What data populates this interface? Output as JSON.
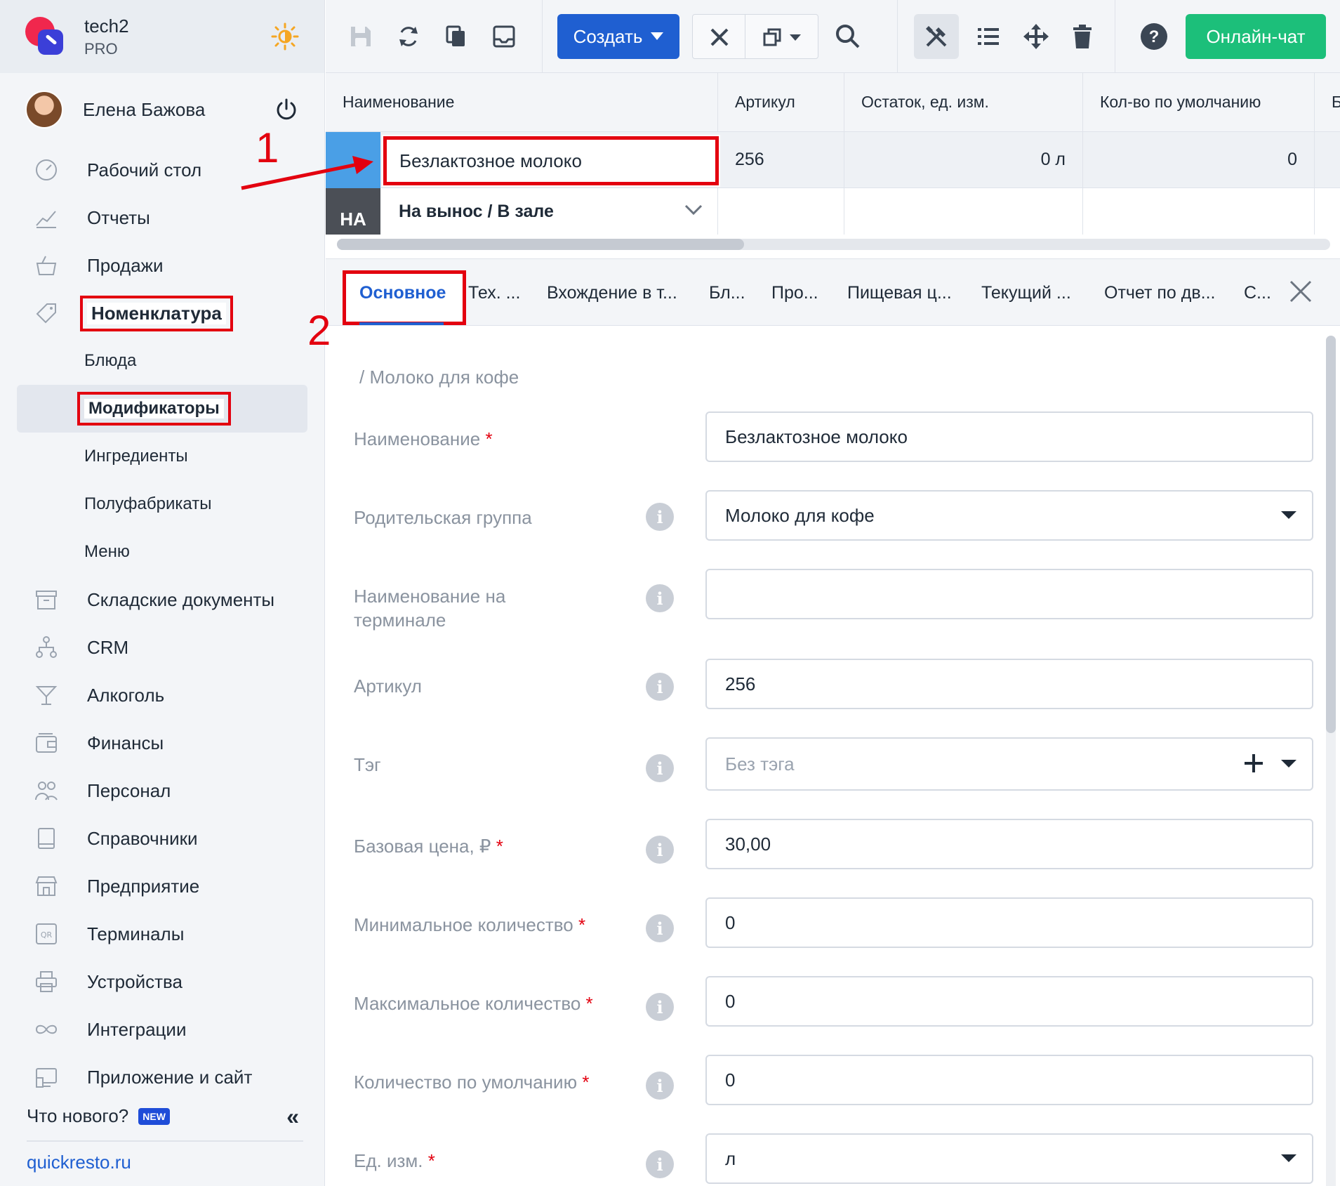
{
  "brand": {
    "name": "tech2",
    "plan": "PRO"
  },
  "user": {
    "name": "Елена Бажова"
  },
  "nav": {
    "desktop": "Рабочий стол",
    "reports": "Отчеты",
    "sales": "Продажи",
    "nomenclature": "Номенклатура",
    "sub": {
      "dishes": "Блюда",
      "modifiers": "Модификаторы",
      "ingredients": "Ингредиенты",
      "semi": "Полуфабрикаты",
      "menu": "Меню"
    },
    "warehouse": "Складские документы",
    "crm": "CRM",
    "alcohol": "Алкоголь",
    "finance": "Финансы",
    "staff": "Персонал",
    "directories": "Справочники",
    "enterprise": "Предприятие",
    "terminals": "Терминалы",
    "devices": "Устройства",
    "integrations": "Интеграции",
    "app_site": "Приложение и сайт"
  },
  "footer": {
    "whats_new": "Что нового?",
    "new_badge": "NEW",
    "site": "quickresto.ru"
  },
  "toolbar": {
    "create": "Создать",
    "chat": "Онлайн-чат"
  },
  "grid": {
    "columns": [
      "Наименование",
      "Артикул",
      "Остаток, ед. изм.",
      "Кол-во по умолчанию",
      "Б"
    ],
    "row1": {
      "name": "Безлактозное молоко",
      "article": "256",
      "stock": "0 л",
      "default_qty": "0"
    },
    "row2": {
      "marker": "НА",
      "name": "На вынос / В зале"
    }
  },
  "tabs": [
    "Основное",
    "Тех. ...",
    "Вхождение в т...",
    "Бл...",
    "Про...",
    "Пищевая ц...",
    "Текущий ...",
    "Отчет по дв...",
    "С..."
  ],
  "annotations": {
    "one": "1",
    "two": "2"
  },
  "form": {
    "breadcrumb": "/ Молоко для кофе",
    "fields": {
      "name": {
        "label": "Наименование",
        "value": "Безлактозное молоко"
      },
      "parent": {
        "label": "Родительская группа",
        "value": "Молоко для кофе"
      },
      "terminal_name": {
        "label": "Наименование на терминале",
        "value": ""
      },
      "article": {
        "label": "Артикул",
        "value": "256"
      },
      "tag": {
        "label": "Тэг",
        "placeholder": "Без тэга"
      },
      "base_price": {
        "label": "Базовая цена, ₽",
        "value": "30,00"
      },
      "min_qty": {
        "label": "Минимальное количество",
        "value": "0"
      },
      "max_qty": {
        "label": "Максимальное количество",
        "value": "0"
      },
      "default_qty": {
        "label": "Количество по умолчанию",
        "value": "0"
      },
      "unit": {
        "label": "Ед. изм.",
        "value": "л"
      }
    },
    "required_mark": "*"
  },
  "colors": {
    "accent": "#1f5fd1",
    "chat": "#1cbf7a",
    "highlight": "#e3000f",
    "brand_red": "#f0274d",
    "brand_blue": "#3b3fd8"
  }
}
